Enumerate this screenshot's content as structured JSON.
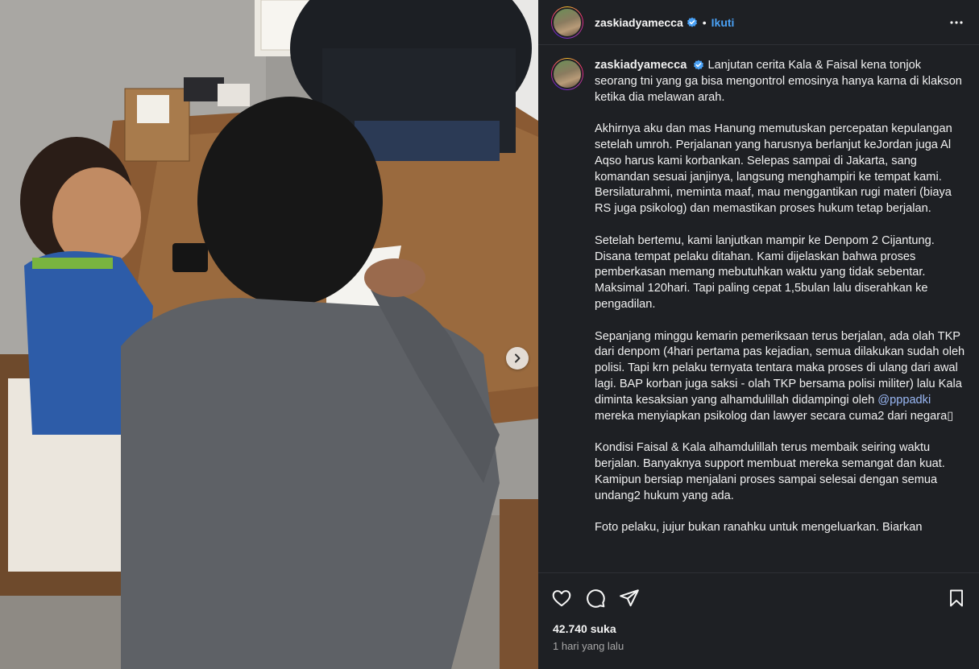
{
  "post": {
    "username": "zaskiadyamecca",
    "dot": "•",
    "follow_label": "Ikuti",
    "caption_paragraphs": [
      "Lanjutan cerita Kala & Faisal kena tonjok seorang tni yang ga bisa mengontrol emosinya hanya karna di klakson ketika dia melawan arah.",
      "Akhirnya aku dan mas Hanung memutuskan percepatan kepulangan setelah umroh. Perjalanan yang harusnya berlanjut keJordan juga Al Aqso harus kami korbankan. Selepas sampai di Jakarta, sang komandan sesuai janjinya, langsung menghampiri ke tempat kami. Bersilaturahmi, meminta maaf, mau menggantikan rugi materi (biaya RS juga psikolog) dan memastikan proses hukum tetap berjalan.",
      "Setelah bertemu, kami lanjutkan mampir ke Denpom 2 Cijantung. Disana tempat pelaku ditahan. Kami dijelaskan bahwa proses pemberkasan memang mebutuhkan waktu yang tidak sebentar. Maksimal 120hari. Tapi paling cepat 1,5bulan lalu diserahkan ke pengadilan."
    ],
    "para4_before_mention": "Sepanjang minggu kemarin pemeriksaan terus berjalan, ada olah TKP dari denpom (4hari pertama pas kejadian, semua dilakukan sudah oleh polisi. Tapi krn pelaku ternyata tentara maka proses di ulang dari awal lagi. BAP korban juga saksi - olah TKP bersama polisi militer) lalu Kala diminta kesaksian yang alhamdulillah didampingi oleh ",
    "mention": "@pppadki",
    "para4_after_mention": " mereka menyiapkan psikolog dan lawyer secara cuma2 dari negara▯",
    "para5": "Kondisi Faisal & Kala alhamdulillah terus membaik seiring waktu berjalan. Banyaknya support membuat mereka semangat dan kuat. Kamipun bersiap menjalani proses sampai selesai dengan semua undang2 hukum yang ada.",
    "para6": "Foto pelaku, jujur bukan ranahku untuk mengeluarkan. Biarkan",
    "likes": "42.740 suka",
    "time": "1 hari yang lalu"
  },
  "icons": {
    "verified": "verified-badge-icon",
    "more": "more-horizontal-icon",
    "like": "heart-icon",
    "comment": "comment-icon",
    "share": "send-icon",
    "save": "bookmark-icon",
    "next": "chevron-right-icon"
  },
  "colors": {
    "accent": "#4aa1f5",
    "panel_bg": "#1e2024",
    "mention": "#9ab8f5"
  }
}
